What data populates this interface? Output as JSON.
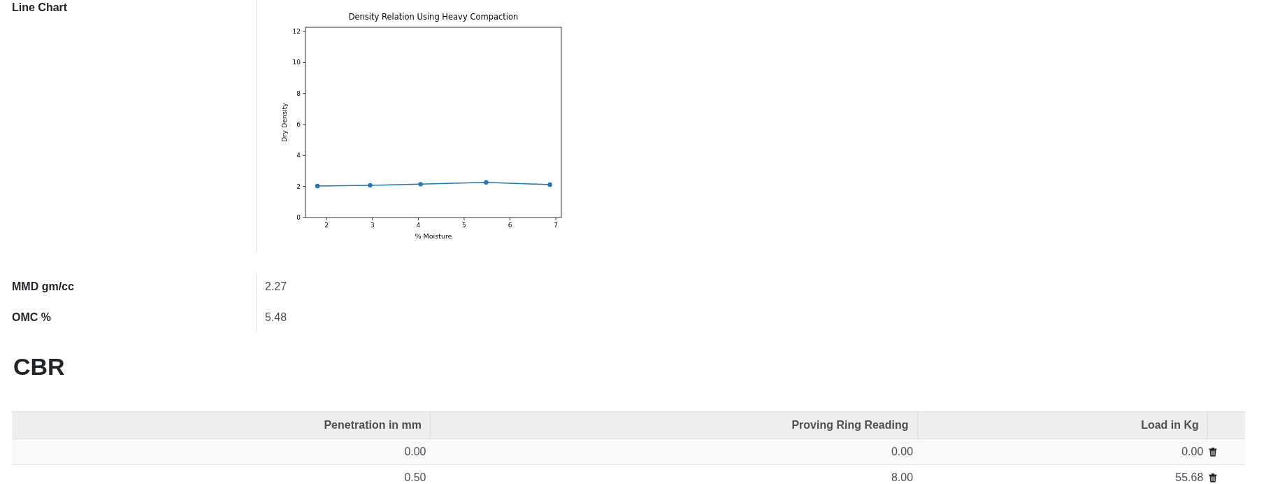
{
  "fields": [
    {
      "label": "Line Chart",
      "kind": "chart",
      "chart_data": {
        "type": "line",
        "title": "Density Relation Using Heavy Compaction",
        "xlabel": "% Moisture",
        "ylabel": "Dry Density",
        "x": [
          1.8,
          2.95,
          4.05,
          5.48,
          6.87
        ],
        "series": [
          {
            "color": "#1f77b4",
            "marker": "o",
            "values": [
              2.03,
              2.08,
              2.15,
              2.27,
              2.12
            ]
          }
        ],
        "xlim": [
          1.54,
          7.12
        ],
        "ylim": [
          0,
          12.27
        ],
        "xticks": [
          2,
          3,
          4,
          5,
          6,
          7
        ],
        "yticks": [
          0,
          2,
          4,
          6,
          8,
          10,
          12
        ]
      }
    },
    {
      "label": "MMD gm/cc",
      "kind": "text",
      "value": "2.27"
    },
    {
      "label": "OMC %",
      "kind": "text",
      "value": "5.48"
    }
  ],
  "section": {
    "title": "CBR"
  },
  "table": {
    "columns": [
      "Penetration in mm",
      "Proving Ring Reading",
      "Load in Kg"
    ],
    "rows": [
      [
        "0.00",
        "0.00",
        "0.00"
      ],
      [
        "0.50",
        "8.00",
        "55.68"
      ]
    ]
  }
}
